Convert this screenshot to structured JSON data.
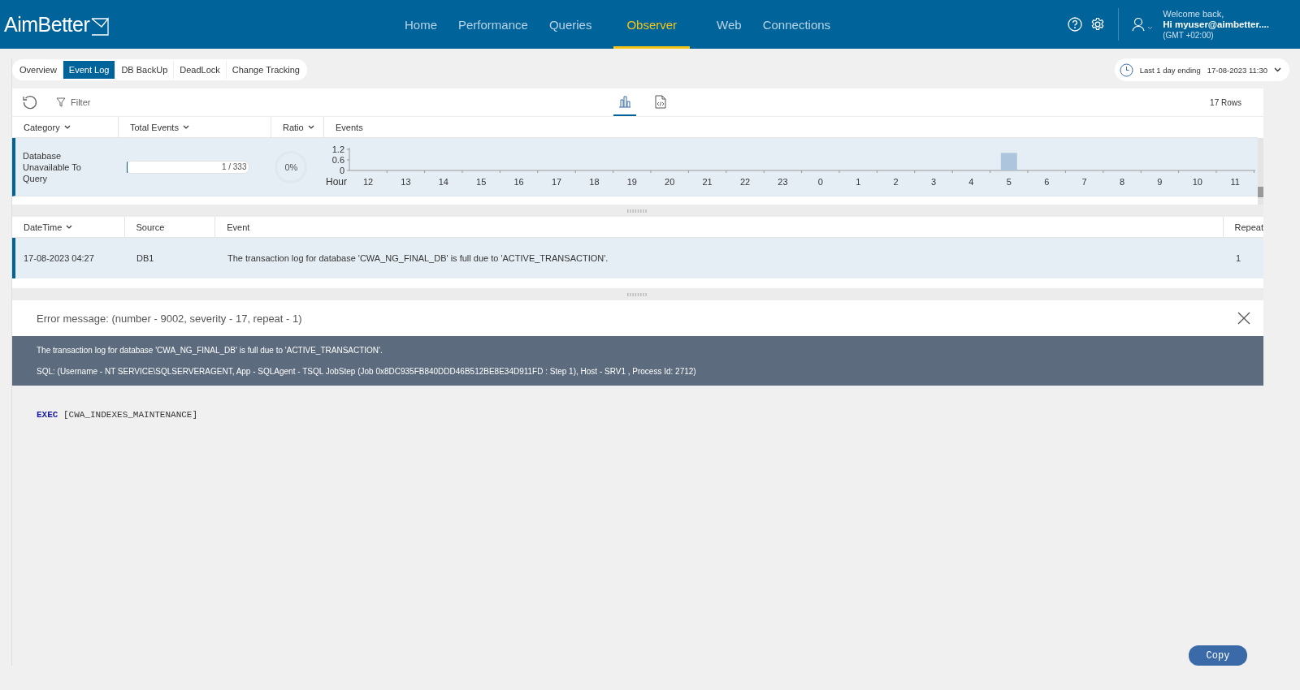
{
  "header": {
    "logo": "AimBetter",
    "nav": [
      {
        "label": "Home",
        "selected": false
      },
      {
        "label": "Performance",
        "selected": false
      },
      {
        "label": "Queries",
        "selected": false
      },
      {
        "label": "Observer",
        "selected": true
      },
      {
        "label": "Web",
        "selected": false
      },
      {
        "label": "Connections",
        "selected": false
      }
    ],
    "user": {
      "greeting": "Welcome back,",
      "name": "Hi myuser@aimbetter....",
      "timezone": "(GMT +02:00)"
    }
  },
  "subtabs": [
    {
      "label": "Overview",
      "selected": false
    },
    {
      "label": "Event Log",
      "selected": true
    },
    {
      "label": "DB BackUp",
      "selected": false
    },
    {
      "label": "DeadLock",
      "selected": false
    },
    {
      "label": "Change Tracking",
      "selected": false
    }
  ],
  "date_range": {
    "label": "Last 1 day ending",
    "value": "17-08-2023 11:30"
  },
  "toolbar": {
    "filter": "Filter",
    "views": [
      {
        "kind": "chart",
        "selected": true
      },
      {
        "kind": "code",
        "selected": false
      }
    ],
    "rows_count": "17 Rows"
  },
  "category_table": {
    "columns": [
      "Category",
      "Total Events",
      "Ratio",
      "Events"
    ],
    "rows": [
      {
        "category": "Database Unavailable To Query",
        "total_events": "1 / 333",
        "level": 0.003,
        "ratio": "0%",
        "selected": true,
        "chart_data": {
          "type": "bar",
          "xlabel": "Hour",
          "categories": [
            "12",
            "13",
            "14",
            "15",
            "16",
            "17",
            "18",
            "19",
            "20",
            "21",
            "22",
            "23",
            "0",
            "1",
            "2",
            "3",
            "4",
            "5",
            "6",
            "7",
            "8",
            "9",
            "10",
            "11"
          ],
          "series": [
            {
              "color": "#adc6de",
              "values": [
                0,
                0,
                0,
                0,
                0,
                0,
                0,
                0,
                0,
                0,
                0,
                0,
                0,
                0,
                0,
                0,
                0,
                1,
                0,
                0,
                0,
                0,
                0,
                0
              ]
            }
          ],
          "ylim": [
            0,
            1.2
          ],
          "yticks": [
            0,
            0.6,
            1.2
          ]
        }
      }
    ]
  },
  "events_table": {
    "columns": [
      "DateTime",
      "Source",
      "Event",
      "Repeat"
    ],
    "rows": [
      {
        "datetime": "17-08-2023 04:27",
        "source": "DB1",
        "event": "The transaction log for database 'CWA_NG_FINAL_DB' is full due to 'ACTIVE_TRANSACTION'.",
        "repeat": "1",
        "selected": true
      }
    ]
  },
  "error_panel": {
    "title": "Error message: (number - 9002, severity - 17, repeat - 1)",
    "message": "The transaction log for database 'CWA_NG_FINAL_DB' is full due to 'ACTIVE_TRANSACTION'.",
    "details": "SQL: (Username - NT SERVICE\\SQLSERVERAGENT, App - SQLAgent - TSQL JobStep (Job 0x8DC935FB840DDD46B512BE8E34D911FD : Step 1), Host - SRV1 , Process Id: 2712)",
    "code": [
      {
        "kind": "keyword",
        "text": "EXEC"
      },
      {
        "kind": "plain",
        "text": "[CWA_INDEXES_MAINTENANCE]"
      }
    ],
    "copy_button": "Copy"
  }
}
